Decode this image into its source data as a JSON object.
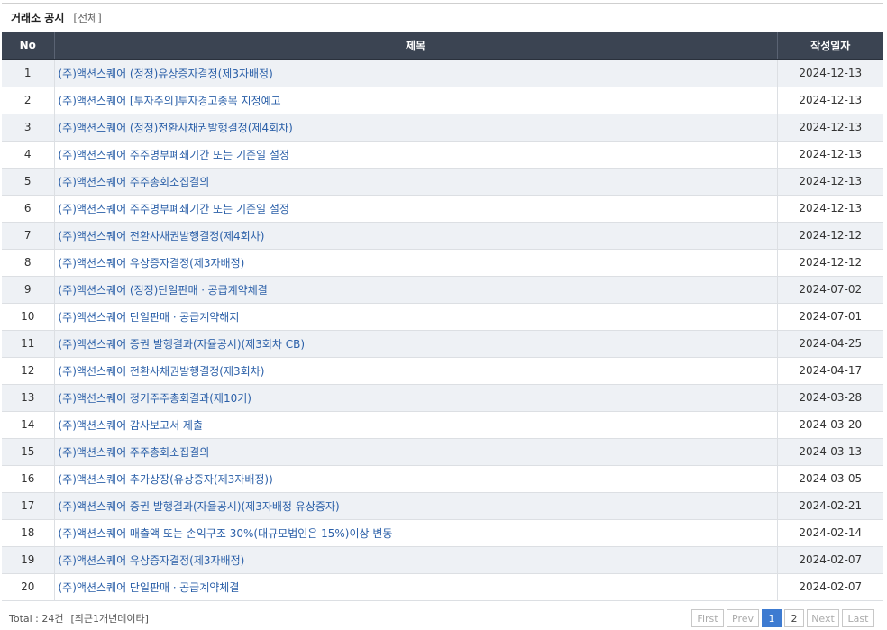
{
  "header": {
    "title": "거래소 공시",
    "filter": "[전체]"
  },
  "table": {
    "columns": [
      "No",
      "제목",
      "작성일자"
    ],
    "rows": [
      {
        "no": "1",
        "title": "(주)액션스퀘어 (정정)유상증자결정(제3자배정)",
        "date": "2024-12-13"
      },
      {
        "no": "2",
        "title": "(주)액션스퀘어 [투자주의]투자경고종목 지정예고",
        "date": "2024-12-13"
      },
      {
        "no": "3",
        "title": "(주)액션스퀘어 (정정)전환사채권발행결정(제4회차)",
        "date": "2024-12-13"
      },
      {
        "no": "4",
        "title": "(주)액션스퀘어 주주명부폐쇄기간 또는 기준일 설정",
        "date": "2024-12-13"
      },
      {
        "no": "5",
        "title": "(주)액션스퀘어 주주총회소집결의",
        "date": "2024-12-13"
      },
      {
        "no": "6",
        "title": "(주)액션스퀘어 주주명부폐쇄기간 또는 기준일 설정",
        "date": "2024-12-13"
      },
      {
        "no": "7",
        "title": "(주)액션스퀘어 전환사채권발행결정(제4회차)",
        "date": "2024-12-12"
      },
      {
        "no": "8",
        "title": "(주)액션스퀘어 유상증자결정(제3자배정)",
        "date": "2024-12-12"
      },
      {
        "no": "9",
        "title": "(주)액션스퀘어 (정정)단일판매ㆍ공급계약체결",
        "date": "2024-07-02"
      },
      {
        "no": "10",
        "title": "(주)액션스퀘어 단일판매ㆍ공급계약해지",
        "date": "2024-07-01"
      },
      {
        "no": "11",
        "title": "(주)액션스퀘어 증권 발행결과(자율공시)(제3회차 CB)",
        "date": "2024-04-25"
      },
      {
        "no": "12",
        "title": "(주)액션스퀘어 전환사채권발행결정(제3회차)",
        "date": "2024-04-17"
      },
      {
        "no": "13",
        "title": "(주)액션스퀘어 정기주주총회결과(제10기)",
        "date": "2024-03-28"
      },
      {
        "no": "14",
        "title": "(주)액션스퀘어 감사보고서 제출",
        "date": "2024-03-20"
      },
      {
        "no": "15",
        "title": "(주)액션스퀘어 주주총회소집결의",
        "date": "2024-03-13"
      },
      {
        "no": "16",
        "title": "(주)액션스퀘어 추가상장(유상증자(제3자배정))",
        "date": "2024-03-05"
      },
      {
        "no": "17",
        "title": "(주)액션스퀘어 증권 발행결과(자율공시)(제3자배정 유상증자)",
        "date": "2024-02-21"
      },
      {
        "no": "18",
        "title": "(주)액션스퀘어 매출액 또는 손익구조 30%(대규모법인은 15%)이상 변동",
        "date": "2024-02-14"
      },
      {
        "no": "19",
        "title": "(주)액션스퀘어 유상증자결정(제3자배정)",
        "date": "2024-02-07"
      },
      {
        "no": "20",
        "title": "(주)액션스퀘어 단일판매ㆍ공급계약체결",
        "date": "2024-02-07"
      }
    ]
  },
  "footer": {
    "total": "Total : 24건",
    "note": "[최근1개년데이타]",
    "pager": {
      "first": "First",
      "prev": "Prev",
      "pages": [
        "1",
        "2"
      ],
      "current": "1",
      "next": "Next",
      "last": "Last"
    }
  },
  "colors": {
    "header_bg": "#3b4452",
    "link": "#2a5fa8",
    "row_alt": "#eef1f5",
    "active_page": "#3d7bd1"
  }
}
